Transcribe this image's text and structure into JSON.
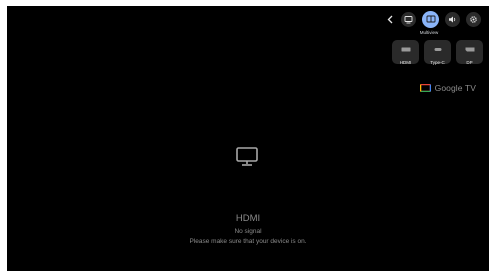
{
  "quick_settings": {
    "active_item_label": "Multiview",
    "icons": [
      "chevron-left-icon",
      "screen-mirror-icon",
      "multiview-icon",
      "sound-output-icon",
      "settings-gear-icon"
    ]
  },
  "sources": [
    {
      "label": "HDMI",
      "icon": "hdmi-port-icon"
    },
    {
      "label": "Type-C",
      "icon": "usb-c-icon"
    },
    {
      "label": "DP",
      "icon": "displayport-icon"
    }
  ],
  "brand": {
    "text": "Google TV"
  },
  "status": {
    "input_name": "HDMI",
    "message": "No signal",
    "hint": "Please make sure that your device is on."
  },
  "colors": {
    "background": "#000000",
    "accent": "#8ab4f8",
    "button": "#2b2b2b"
  }
}
